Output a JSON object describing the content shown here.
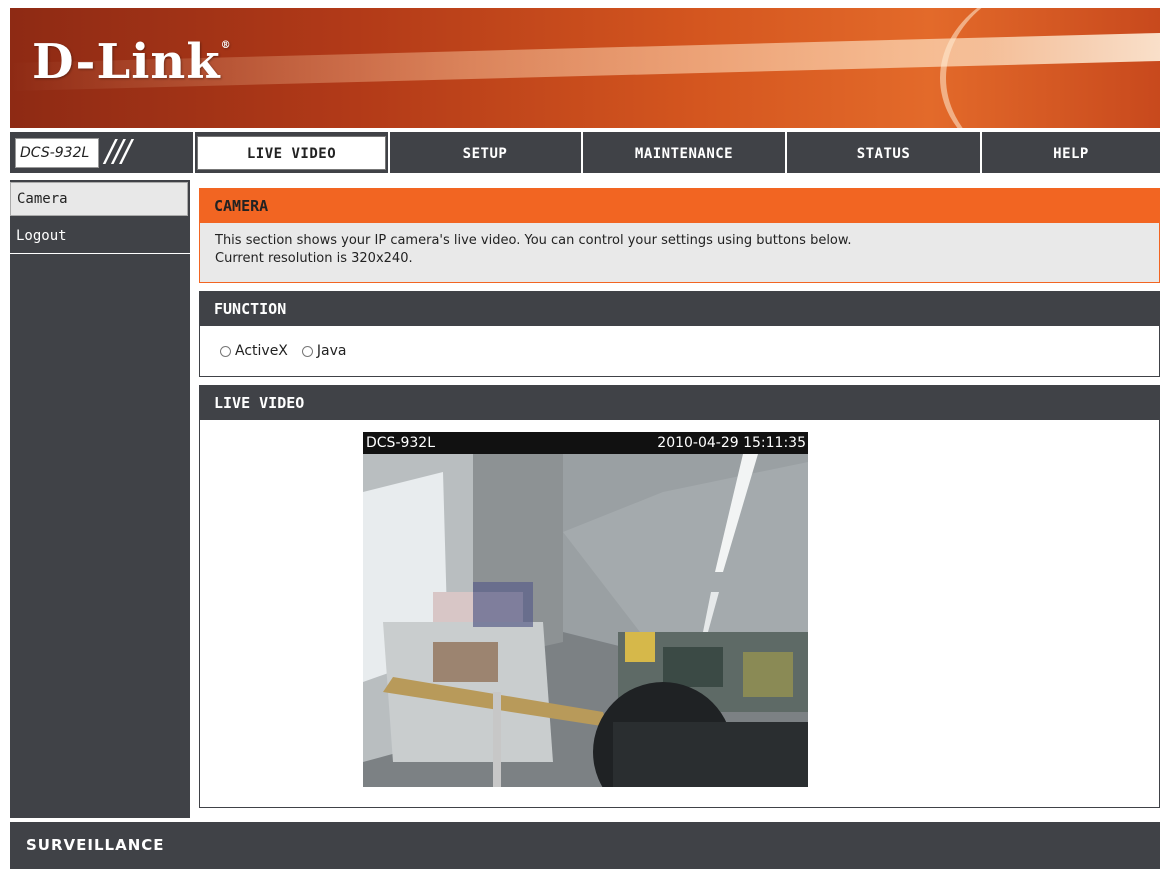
{
  "brand": {
    "logo": "D-Link",
    "mark": "®"
  },
  "nav": {
    "model": "DCS-932L",
    "slashes": "///",
    "tabs": [
      {
        "label": "LIVE VIDEO",
        "active": true
      },
      {
        "label": "SETUP",
        "active": false
      },
      {
        "label": "MAINTENANCE",
        "active": false
      },
      {
        "label": "STATUS",
        "active": false
      },
      {
        "label": "HELP",
        "active": false
      }
    ]
  },
  "sidebar": {
    "items": [
      {
        "label": "Camera",
        "active": true
      },
      {
        "label": "Logout",
        "active": false
      }
    ]
  },
  "camera": {
    "title": "CAMERA",
    "line1": "This section shows your IP camera's live video. You can control your settings using buttons below.",
    "line2": "Current resolution is 320x240."
  },
  "function": {
    "title": "FUNCTION",
    "options": [
      {
        "label": "ActiveX",
        "selected": false
      },
      {
        "label": "Java",
        "selected": false
      }
    ]
  },
  "live": {
    "title": "LIVE VIDEO",
    "overlay_name": "DCS-932L",
    "overlay_time": "2010-04-29 15:11:35"
  },
  "footer": {
    "label": "SURVEILLANCE"
  },
  "colors": {
    "accent": "#f26522",
    "dark": "#404247"
  }
}
